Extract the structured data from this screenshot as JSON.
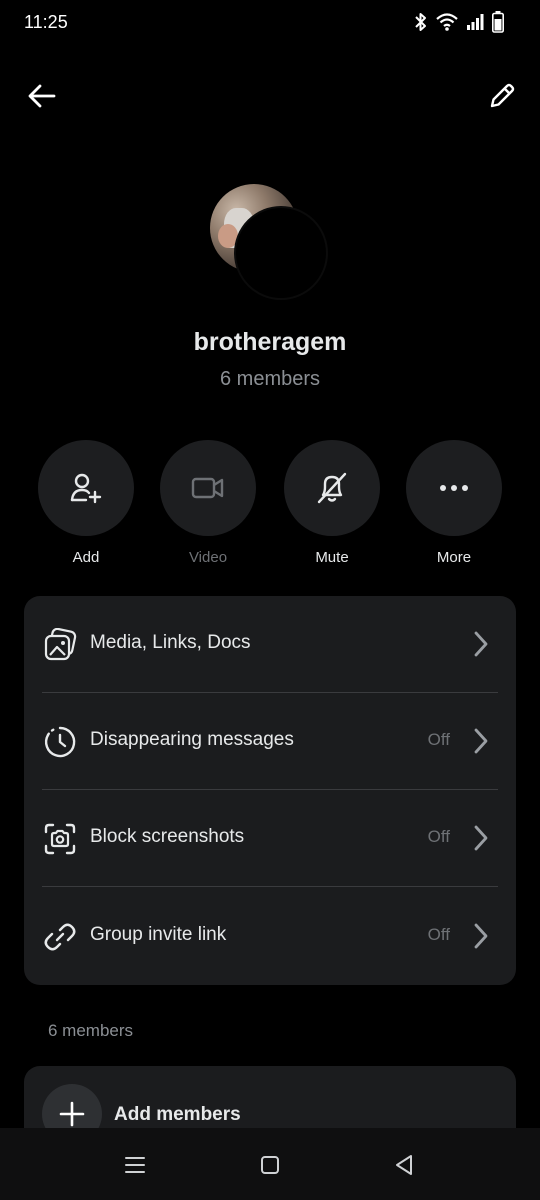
{
  "status_bar": {
    "time": "11:25",
    "icons": [
      "bluetooth-icon",
      "wifi-icon",
      "signal-icon",
      "battery-icon"
    ]
  },
  "top_bar": {
    "back_icon": "arrow-left-icon",
    "edit_icon": "pencil-icon"
  },
  "group": {
    "name": "brotheragem",
    "member_count": "6 members"
  },
  "actions": [
    {
      "label": "Add",
      "icon": "add-person-icon",
      "enabled": true
    },
    {
      "label": "Video",
      "icon": "video-camera-icon",
      "enabled": false
    },
    {
      "label": "Mute",
      "icon": "bell-muted-icon",
      "enabled": true
    },
    {
      "label": "More",
      "icon": "more-dots-icon",
      "enabled": true
    }
  ],
  "settings": [
    {
      "label": "Media, Links, Docs",
      "value": "",
      "icon": "media-gallery-icon"
    },
    {
      "label": "Disappearing messages",
      "value": "Off",
      "icon": "timer-icon"
    },
    {
      "label": "Block screenshots",
      "value": "Off",
      "icon": "screenshot-camera-icon"
    },
    {
      "label": "Group invite link",
      "value": "Off",
      "icon": "link-icon"
    }
  ],
  "members_section": {
    "label": "6 members",
    "add_members_label": "Add members"
  },
  "colors": {
    "background": "#000000",
    "card": "#1b1c1e",
    "action_circle": "#1d1e20",
    "primary_text": "#e7e9ea",
    "secondary_text": "#8b8f94",
    "muted_text": "#6e7175"
  }
}
